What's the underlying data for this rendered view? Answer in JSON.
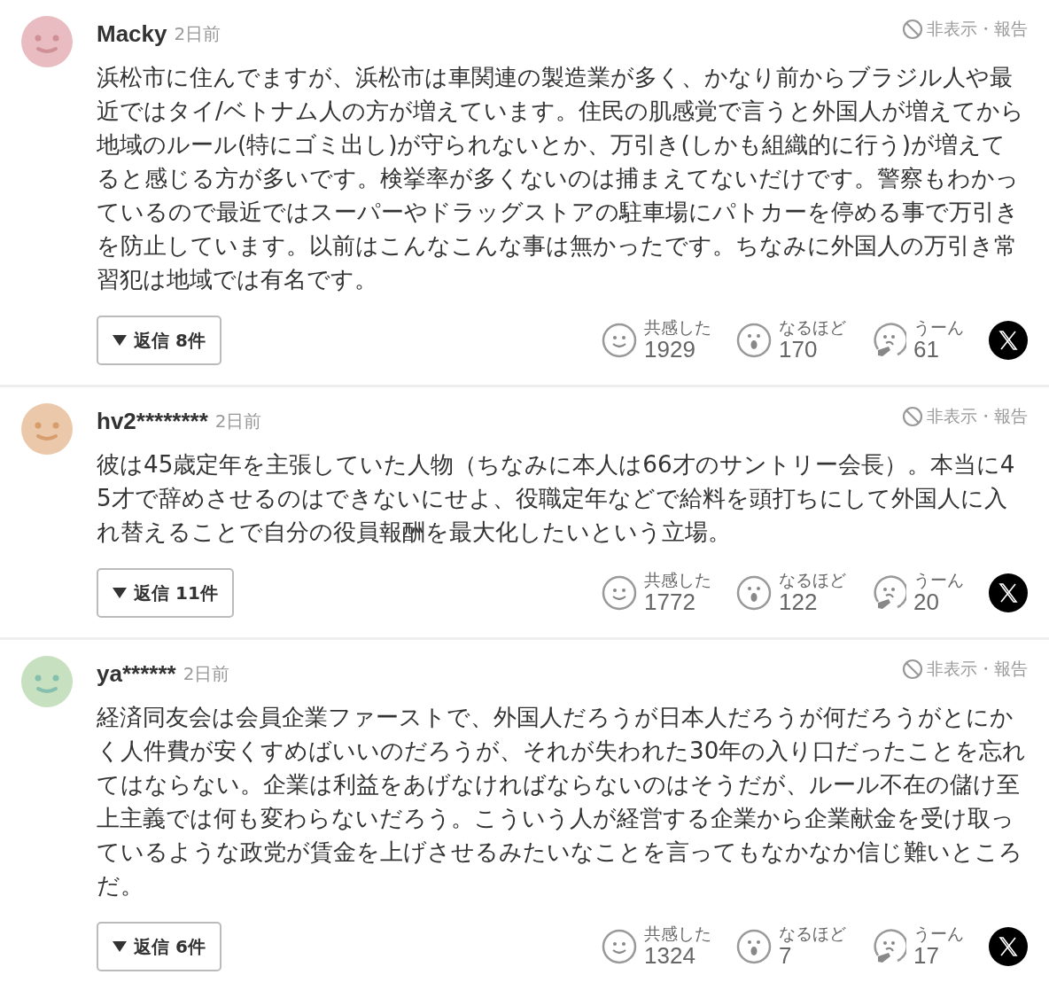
{
  "comments": [
    {
      "color": "#e8bcc0",
      "name": "Macky",
      "time": "2日前",
      "hide_report": "非表示・報告",
      "body": "浜松市に住んでますが、浜松市は車関連の製造業が多く、かなり前からブラジル人や最近ではタイ/ベトナム人の方が増えています。住民の肌感覚で言うと外国人が増えてから地域のルール(特にゴミ出し)が守られないとか、万引き(しかも組織的に行う)が増えてると感じる方が多いです。検挙率が多くないのは捕まえてないだけです。警察もわかっているので最近ではスーパーやドラッグストアの駐車場にパトカーを停める事で万引きを防止しています。以前はこんなこんな事は無かったです。ちなみに外国人の万引き常習犯は地域では有名です。",
      "replies": "返信 8件",
      "reactions": [
        {
          "kind": "smile",
          "label": "共感した",
          "count": "1929"
        },
        {
          "kind": "surprised",
          "label": "なるほど",
          "count": "170"
        },
        {
          "kind": "thinking",
          "label": "うーん",
          "count": "61"
        }
      ]
    },
    {
      "color": "#ebc8aa",
      "name": "hv2********",
      "time": "2日前",
      "hide_report": "非表示・報告",
      "body": "彼は45歳定年を主張していた人物（ちなみに本人は66才のサントリー会長）。本当に45才で辞めさせるのはできないにせよ、役職定年などで給料を頭打ちにして外国人に入れ替えることで自分の役員報酬を最大化したいという立場。",
      "replies": "返信 11件",
      "reactions": [
        {
          "kind": "smile",
          "label": "共感した",
          "count": "1772"
        },
        {
          "kind": "surprised",
          "label": "なるほど",
          "count": "122"
        },
        {
          "kind": "thinking",
          "label": "うーん",
          "count": "20"
        }
      ]
    },
    {
      "color": "#c6e0c0",
      "name": "ya******",
      "time": "2日前",
      "hide_report": "非表示・報告",
      "body": "経済同友会は会員企業ファーストで、外国人だろうが日本人だろうが何だろうがとにかく人件費が安くすめばいいのだろうが、それが失われた30年の入り口だったことを忘れてはならない。企業は利益をあげなければならないのはそうだが、ルール不在の儲け至上主義では何も変わらないだろう。こういう人が経営する企業から企業献金を受け取っているような政党が賃金を上げさせるみたいなことを言ってもなかなか信じ難いところだ。",
      "replies": "返信 6件",
      "reactions": [
        {
          "kind": "smile",
          "label": "共感した",
          "count": "1324"
        },
        {
          "kind": "surprised",
          "label": "なるほど",
          "count": "7"
        },
        {
          "kind": "thinking",
          "label": "うーん",
          "count": "17"
        }
      ]
    }
  ]
}
